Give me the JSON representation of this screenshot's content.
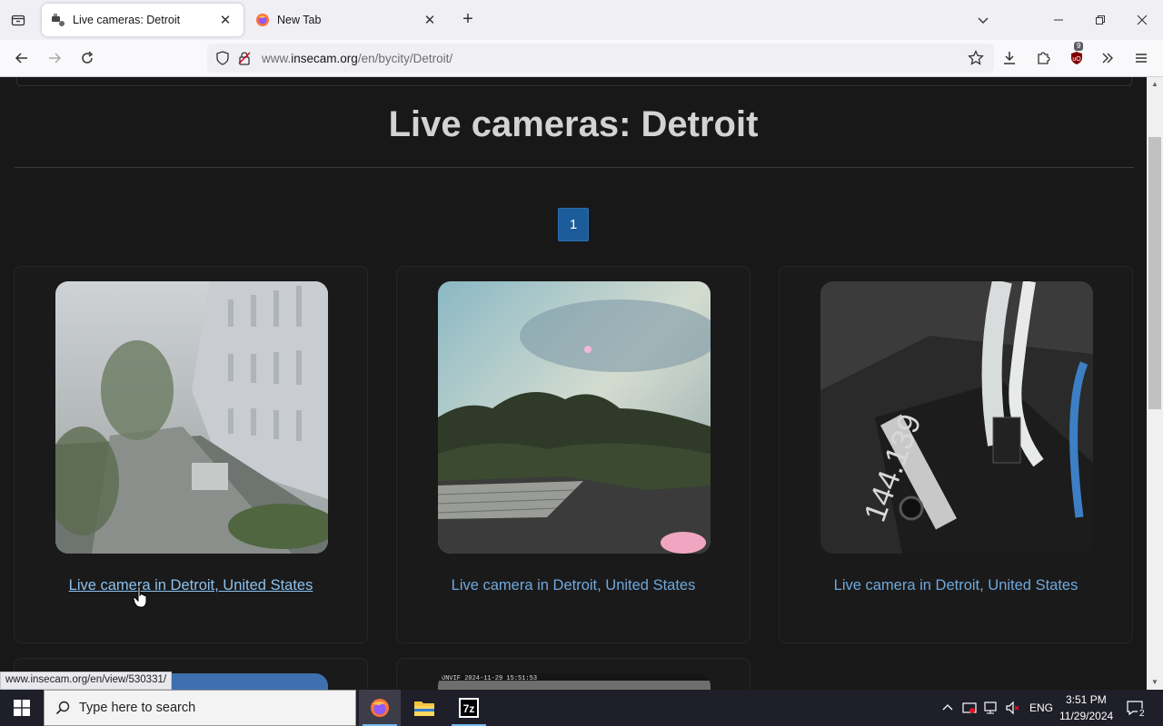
{
  "browser": {
    "tabs": [
      {
        "title": "Live cameras: Detroit",
        "active": true
      },
      {
        "title": "New Tab",
        "active": false
      }
    ],
    "url": {
      "prefix": "www.",
      "host": "insecam.org",
      "path": "/en/bycity/Detroit/"
    },
    "extension_badge": "9",
    "status_url": "www.insecam.org/en/view/530331/"
  },
  "page": {
    "heading": "Live cameras: Detroit",
    "pagination": [
      "1"
    ],
    "cameras": [
      {
        "caption": "Live camera in Detroit, United States"
      },
      {
        "caption": "Live camera in Detroit, United States"
      },
      {
        "caption": "Live camera in Detroit, United States"
      }
    ],
    "overlay_text": "ONVIF 2024-11-29 15:51:53",
    "marker_text": "144.139"
  },
  "taskbar": {
    "search_placeholder": "Type here to search",
    "language": "ENG",
    "time": "3:51 PM",
    "date": "11/29/2024",
    "notification_count": "2",
    "app_7z_label": "7z"
  },
  "colors": {
    "link": "#6fa8dc",
    "pager_bg": "#1d5c9a",
    "page_bg": "#181818"
  }
}
